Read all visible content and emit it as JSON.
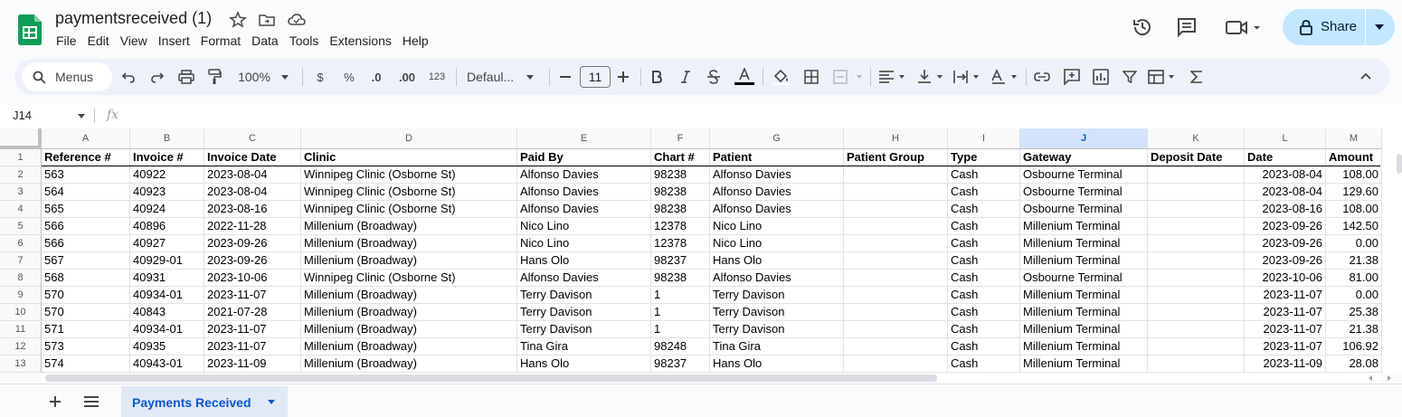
{
  "app": {
    "title": "paymentsreceived (1)",
    "menu": [
      "File",
      "Edit",
      "View",
      "Insert",
      "Format",
      "Data",
      "Tools",
      "Extensions",
      "Help"
    ],
    "share_label": "Share"
  },
  "toolbar": {
    "search_label": "Menus",
    "zoom": "100%",
    "currency": "$",
    "percent": "%",
    "dec_decrease": ".0",
    "dec_increase": ".00",
    "number_format": "123",
    "font": "Defaul...",
    "font_size": "11"
  },
  "formula_bar": {
    "cell_ref": "J14",
    "fx": "fx"
  },
  "columns": [
    "A",
    "B",
    "C",
    "D",
    "E",
    "F",
    "G",
    "H",
    "I",
    "J",
    "K",
    "L",
    "M"
  ],
  "selected_column": "J",
  "headers": [
    "Reference #",
    "Invoice #",
    "Invoice Date",
    "Clinic",
    "Paid By",
    "Chart #",
    "Patient",
    "Patient Group",
    "Type",
    "Gateway",
    "Deposit Date",
    "Date",
    "Amount"
  ],
  "rows": [
    [
      "563",
      "40922",
      "2023-08-04",
      "Winnipeg Clinic (Osborne St)",
      "Alfonso Davies",
      "98238",
      "Alfonso Davies",
      "",
      "Cash",
      "Osbourne Terminal",
      "",
      "2023-08-04",
      "108.00"
    ],
    [
      "564",
      "40923",
      "2023-08-04",
      "Winnipeg Clinic (Osborne St)",
      "Alfonso Davies",
      "98238",
      "Alfonso Davies",
      "",
      "Cash",
      "Osbourne Terminal",
      "",
      "2023-08-04",
      "129.60"
    ],
    [
      "565",
      "40924",
      "2023-08-16",
      "Winnipeg Clinic (Osborne St)",
      "Alfonso Davies",
      "98238",
      "Alfonso Davies",
      "",
      "Cash",
      "Osbourne Terminal",
      "",
      "2023-08-16",
      "108.00"
    ],
    [
      "566",
      "40896",
      "2022-11-28",
      "Millenium (Broadway)",
      "Nico Lino",
      "12378",
      "Nico Lino",
      "",
      "Cash",
      "Millenium Terminal",
      "",
      "2023-09-26",
      "142.50"
    ],
    [
      "566",
      "40927",
      "2023-09-26",
      "Millenium (Broadway)",
      "Nico Lino",
      "12378",
      "Nico Lino",
      "",
      "Cash",
      "Millenium Terminal",
      "",
      "2023-09-26",
      "0.00"
    ],
    [
      "567",
      "40929-01",
      "2023-09-26",
      "Millenium (Broadway)",
      "Hans Olo",
      "98237",
      "Hans Olo",
      "",
      "Cash",
      "Millenium Terminal",
      "",
      "2023-09-26",
      "21.38"
    ],
    [
      "568",
      "40931",
      "2023-10-06",
      "Winnipeg Clinic (Osborne St)",
      "Alfonso Davies",
      "98238",
      "Alfonso Davies",
      "",
      "Cash",
      "Osbourne Terminal",
      "",
      "2023-10-06",
      "81.00"
    ],
    [
      "570",
      "40934-01",
      "2023-11-07",
      "Millenium (Broadway)",
      "Terry Davison",
      "1",
      "Terry Davison",
      "",
      "Cash",
      "Millenium Terminal",
      "",
      "2023-11-07",
      "0.00"
    ],
    [
      "570",
      "40843",
      "2021-07-28",
      "Millenium (Broadway)",
      "Terry Davison",
      "1",
      "Terry Davison",
      "",
      "Cash",
      "Millenium Terminal",
      "",
      "2023-11-07",
      "25.38"
    ],
    [
      "571",
      "40934-01",
      "2023-11-07",
      "Millenium (Broadway)",
      "Terry Davison",
      "1",
      "Terry Davison",
      "",
      "Cash",
      "Millenium Terminal",
      "",
      "2023-11-07",
      "21.38"
    ],
    [
      "573",
      "40935",
      "2023-11-07",
      "Millenium (Broadway)",
      "Tina Gira",
      "98248",
      "Tina Gira",
      "",
      "Cash",
      "Millenium Terminal",
      "",
      "2023-11-07",
      "106.92"
    ],
    [
      "574",
      "40943-01",
      "2023-11-09",
      "Millenium (Broadway)",
      "Hans Olo",
      "98237",
      "Hans Olo",
      "",
      "Cash",
      "Millenium Terminal",
      "",
      "2023-11-09",
      "28.08"
    ]
  ],
  "sheet": {
    "tab_name": "Payments Received"
  },
  "colors": {
    "accent": "#0b57d0",
    "share_bg": "#c2e7ff",
    "logo_green": "#0f9d58"
  }
}
